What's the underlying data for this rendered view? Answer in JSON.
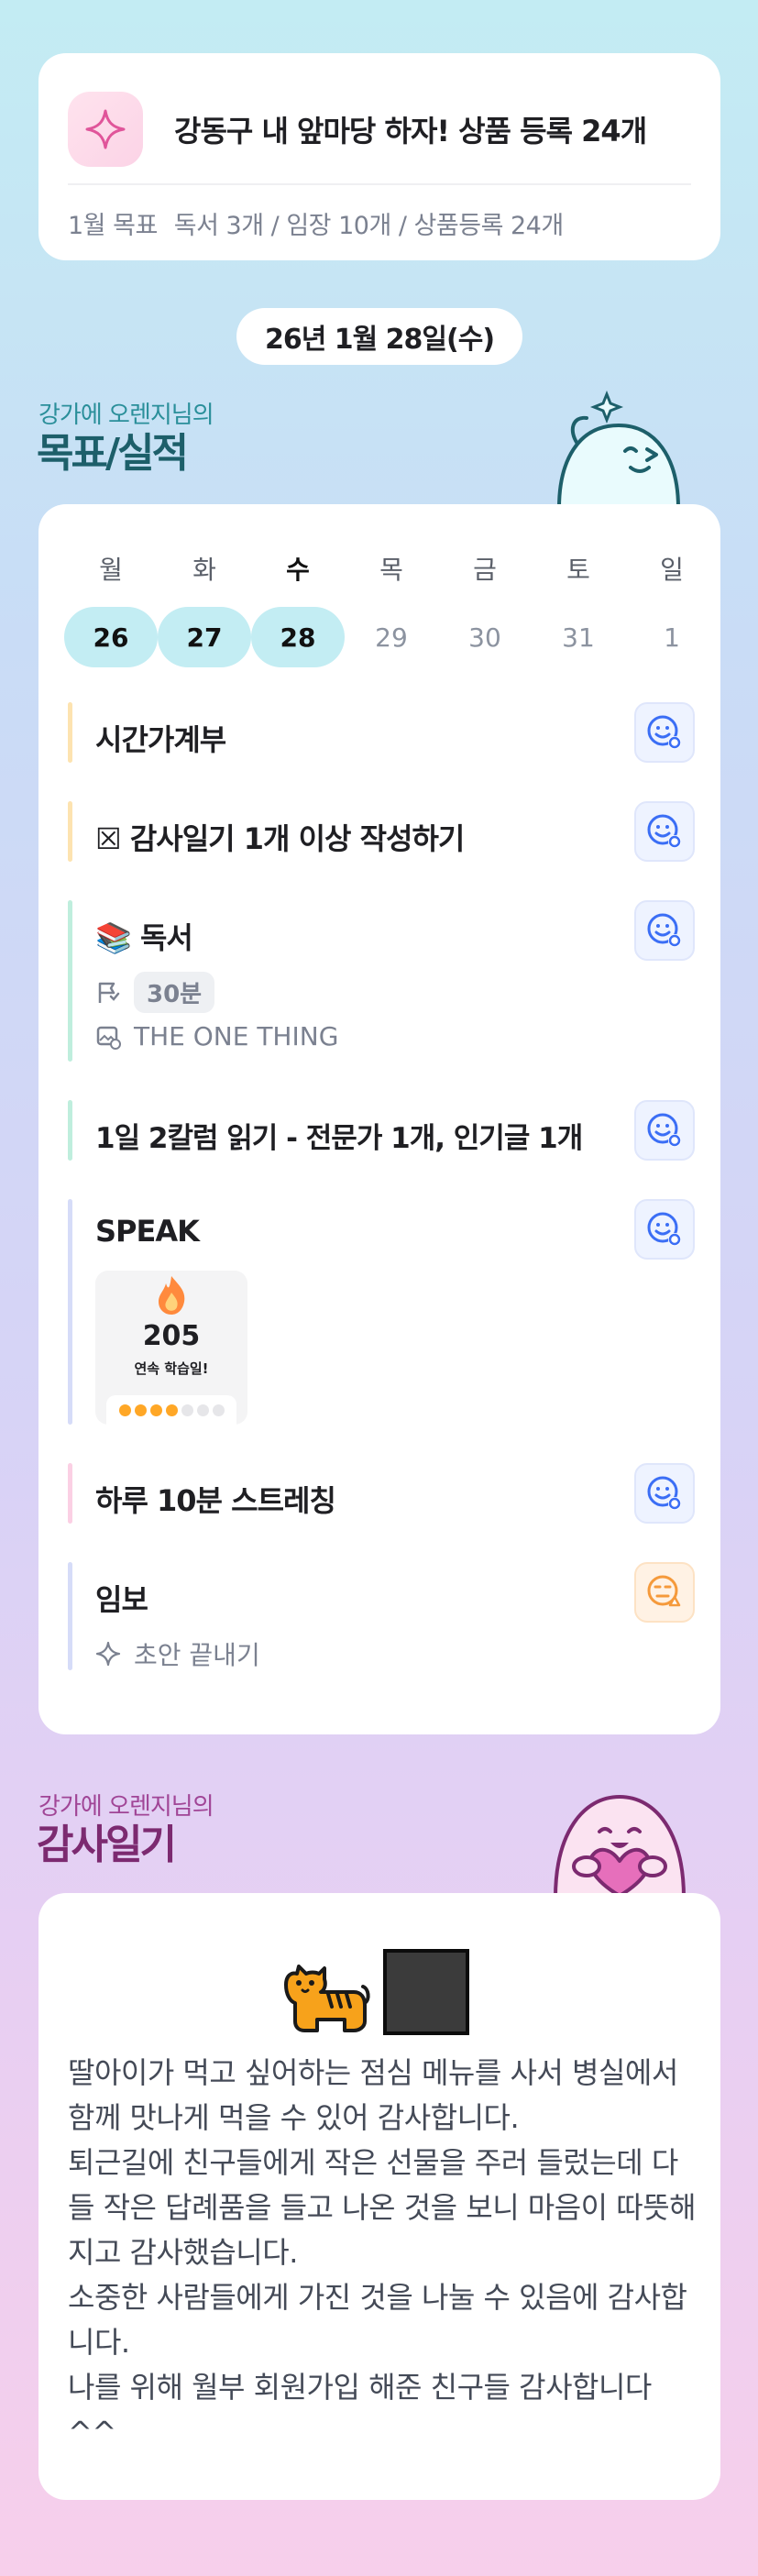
{
  "goal": {
    "title": "강동구 내 앞마당 하자! 상품 등록 24개",
    "sub_label": "1월 목표",
    "sub_text": "독서 3개 / 임장 10개 / 상품등록 24개"
  },
  "date": "26년 1월 28일(수)",
  "records_header": {
    "small": "강가에 오렌지님의",
    "big": "목표/실적"
  },
  "week": {
    "days": [
      "월",
      "화",
      "수",
      "목",
      "금",
      "토",
      "일"
    ],
    "dates": [
      "26",
      "27",
      "28",
      "29",
      "30",
      "31",
      "1"
    ],
    "done": [
      true,
      true,
      true,
      false,
      false,
      false,
      false
    ],
    "today_index": 2
  },
  "tasks": [
    {
      "title": "시간가계부",
      "bar_color": "#fde3b0"
    },
    {
      "title": "☒ 감사일기 1개 이상 작성하기",
      "bar_color": "#fde3b0"
    },
    {
      "title": "📚 독서",
      "bar_color": "#bfeedd",
      "duration": "30분",
      "book": "THE ONE THING"
    },
    {
      "title": "1일 2칼럼 읽기 - 전문가 1개, 인기글 1개",
      "bar_color": "#bfeedd"
    },
    {
      "title": "SPEAK",
      "bar_color": "#d6dcf8",
      "streak_count": "205",
      "streak_label": "연속 학습일!"
    },
    {
      "title": "하루 10분 스트레칭",
      "bar_color": "#fbd0e4"
    },
    {
      "title": "임보",
      "bar_color": "#d6dcf8",
      "note": "초안 끝내기"
    }
  ],
  "gratitude_header": {
    "small": "강가에 오렌지님의",
    "big": "감사일기"
  },
  "gratitude": {
    "paragraphs": [
      "딸아이가 먹고 싶어하는 점심 메뉴를 사서 병실에서 함께 맛나게 먹을 수 있어 감사합니다.",
      "퇴근길에 친구들에게 작은 선물을 주러 들렀는데 다들 작은 답례품을 들고 나온 것을 보니 마음이 따뜻해지고 감사했습니다.",
      "소중한 사람들에게 가진 것을 나눌 수 있음에 감사합니다.",
      "나를 위해 월부 회원가입 해준 친구들 감사합니다 ^^"
    ]
  },
  "colors": {
    "teal_header": "#2a8f9a",
    "teal_big": "#1d5f6a",
    "purple_header": "#a04596",
    "purple_big": "#7c2a70",
    "accent_blue": "#3b6ef5",
    "accent_orange": "#f59a3b"
  }
}
